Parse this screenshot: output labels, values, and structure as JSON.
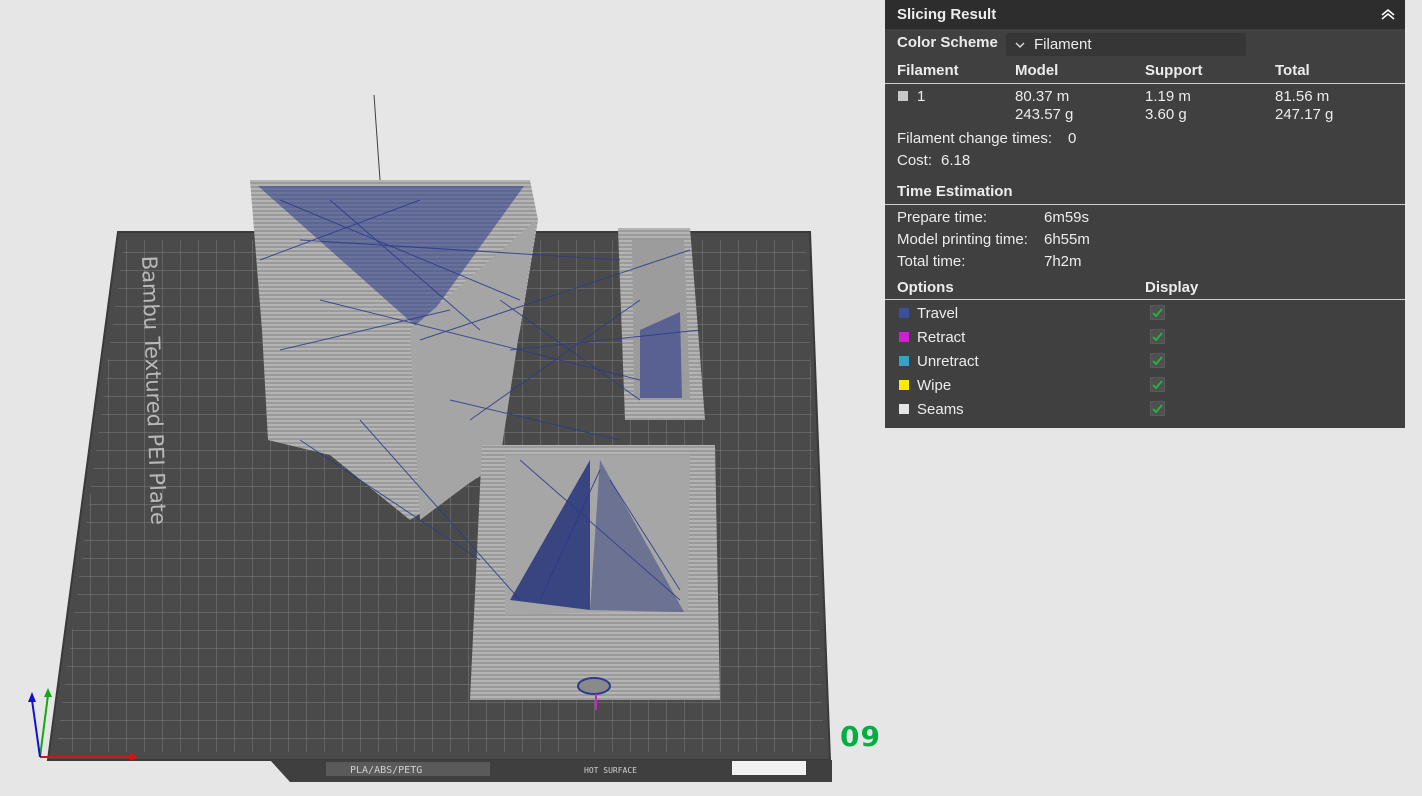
{
  "plate_number": "09",
  "bed": {
    "brand_text": "Bambu Textured PEI Plate",
    "filament_label": "PLA/ABS/PETG",
    "surface_label": "HOT SURFACE"
  },
  "panel": {
    "title": "Slicing Result",
    "color_scheme_label": "Color Scheme",
    "color_scheme_value": "Filament",
    "filament_table": {
      "headers": [
        "Filament",
        "Model",
        "Support",
        "Total"
      ],
      "row": {
        "id": "1",
        "model_len": "80.37 m",
        "model_wt": "243.57 g",
        "support_len": "1.19 m",
        "support_wt": "3.60 g",
        "total_len": "81.56 m",
        "total_wt": "247.17 g"
      },
      "swatch_color": "#c8c8c8"
    },
    "change_times_label": "Filament change times:",
    "change_times_value": "0",
    "cost_label": "Cost:",
    "cost_value": "6.18",
    "time_title": "Time Estimation",
    "prepare_label": "Prepare time:",
    "prepare_value": "6m59s",
    "model_time_label": "Model printing time:",
    "model_time_value": "6h55m",
    "total_time_label": "Total time:",
    "total_time_value": "7h2m",
    "options_label": "Options",
    "display_label": "Display",
    "options": [
      {
        "label": "Travel",
        "color": "#3a4f9e",
        "checked": true
      },
      {
        "label": "Retract",
        "color": "#cc22cc",
        "checked": true
      },
      {
        "label": "Unretract",
        "color": "#3aa0c8",
        "checked": true
      },
      {
        "label": "Wipe",
        "color": "#ffea00",
        "checked": true
      },
      {
        "label": "Seams",
        "color": "#e6e6e6",
        "checked": true
      }
    ]
  }
}
